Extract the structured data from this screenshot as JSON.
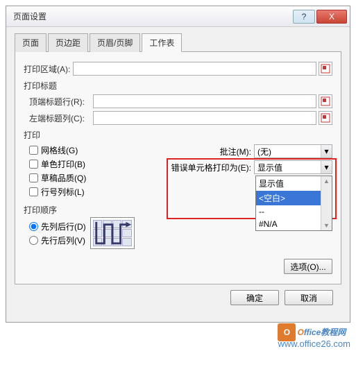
{
  "dialog": {
    "title": "页面设置",
    "help_icon": "?",
    "close_icon": "X"
  },
  "tabs": {
    "page": "页面",
    "margin": "页边距",
    "headerfooter": "页眉/页脚",
    "sheet": "工作表"
  },
  "labels": {
    "print_area": "打印区域(A):",
    "print_titles": "打印标题",
    "top_rows": "顶端标题行(R):",
    "left_cols": "左端标题列(C):",
    "print": "打印",
    "gridlines": "网格线(G)",
    "bw": "单色打印(B)",
    "draft": "草稿品质(Q)",
    "rowcol": "行号列标(L)",
    "comments": "批注(M):",
    "comments_value": "(无)",
    "errors": "错误单元格打印为(E):",
    "errors_value": "显示值",
    "order": "打印顺序",
    "over_down": "先列后行(D)",
    "down_over": "先行后列(V)",
    "options": "选项(O)...",
    "ok": "确定",
    "cancel": "取消"
  },
  "dropdown": {
    "opt1": "显示值",
    "opt2": "<空白>",
    "opt3": "--",
    "opt4": "#N/A"
  },
  "watermark": {
    "brand_o": "O",
    "brand_rest": "ffice教程网",
    "url": "www.office26.com",
    "square": "O"
  }
}
